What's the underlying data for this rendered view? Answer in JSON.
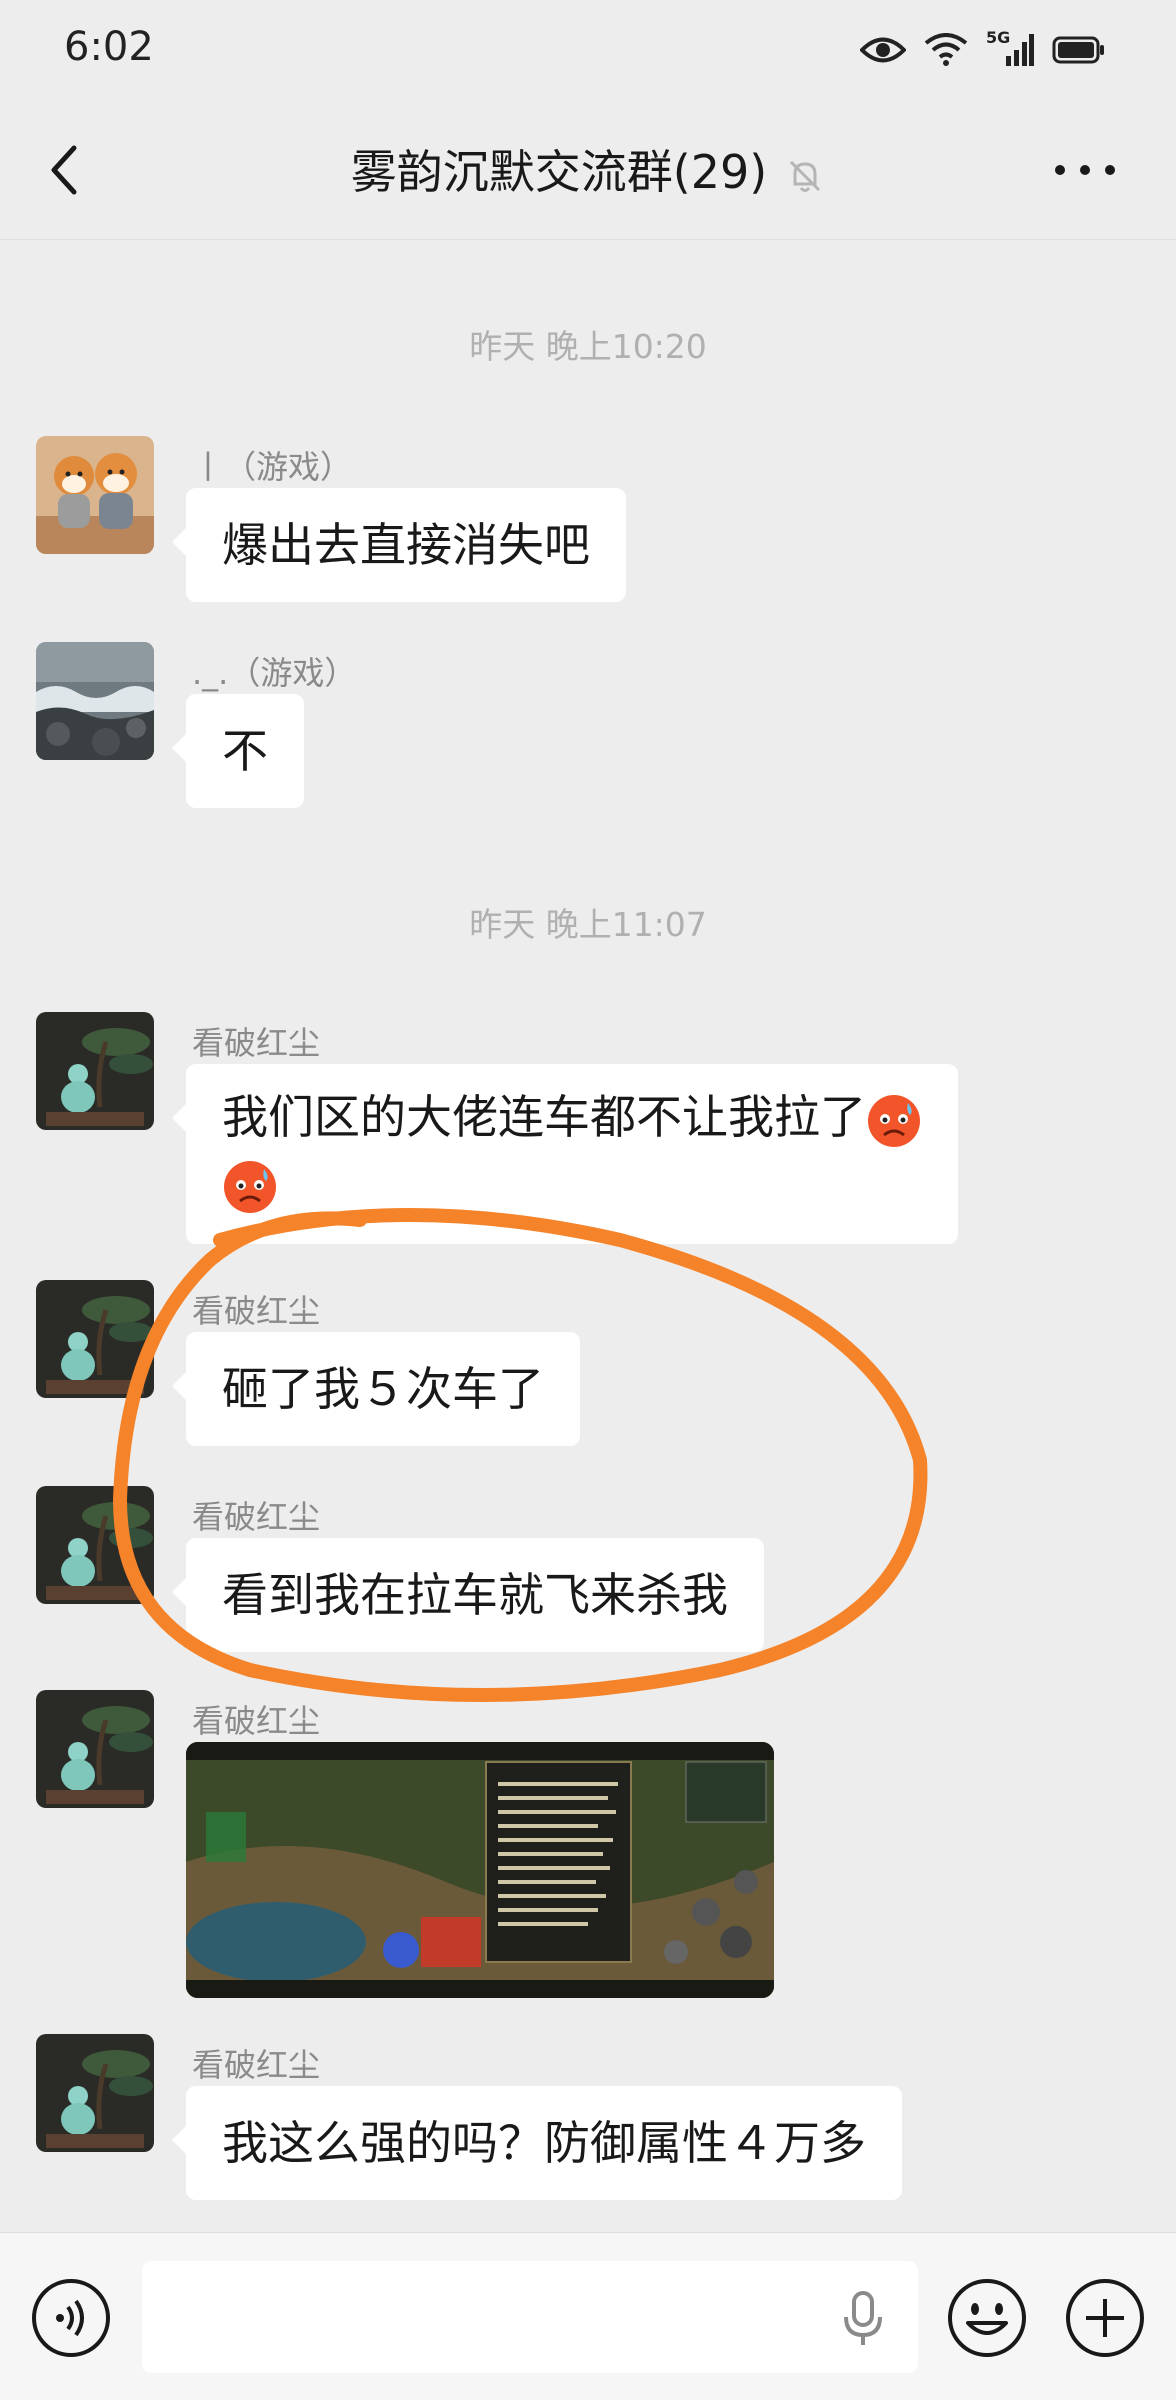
{
  "status_bar": {
    "time": "6:02",
    "network": "5G",
    "icons": [
      "eye-icon",
      "wifi-icon",
      "signal-icon",
      "battery-icon"
    ]
  },
  "header": {
    "title": "雾韵沉默交流群(29)",
    "back_icon": "chevron-left-icon",
    "mute_icon": "bell-off-icon",
    "more_icon": "more-dots-icon"
  },
  "chat": {
    "timestamps": [
      "昨天 晚上10:20",
      "昨天 晚上11:07"
    ],
    "messages": [
      {
        "sender": "丨（游戏）",
        "text": "爆出去直接消失吧",
        "avatar": "shiba-dogs-avatar"
      },
      {
        "sender": "._.（游戏）",
        "text": "不",
        "avatar": "sea-waves-avatar"
      },
      {
        "sender": "看破红尘",
        "text_line1": "我们区的大佬连车都不让我拉了",
        "text_line2": "",
        "emoji": "worried-face-emoji",
        "avatar": "gourd-bonsai-avatar"
      },
      {
        "sender": "看破红尘",
        "text": "砸了我５次车了",
        "avatar": "gourd-bonsai-avatar"
      },
      {
        "sender": "看破红尘",
        "text": "看到我在拉车就飞来杀我",
        "avatar": "gourd-bonsai-avatar"
      },
      {
        "sender": "看破红尘",
        "image": "game-screenshot-image",
        "avatar": "gourd-bonsai-avatar"
      },
      {
        "sender": "看破红尘",
        "text": "我这么强的吗？防御属性４万多",
        "avatar": "gourd-bonsai-avatar"
      }
    ]
  },
  "input_bar": {
    "value": "",
    "placeholder": "",
    "icons": [
      "voice-icon",
      "microphone-icon",
      "emoji-icon",
      "plus-icon"
    ]
  },
  "colors": {
    "background": "#ededed",
    "bubble": "#ffffff",
    "annotation": "#f5832a",
    "timestamp": "#b0b0b0",
    "sender": "#8a8a8a"
  }
}
